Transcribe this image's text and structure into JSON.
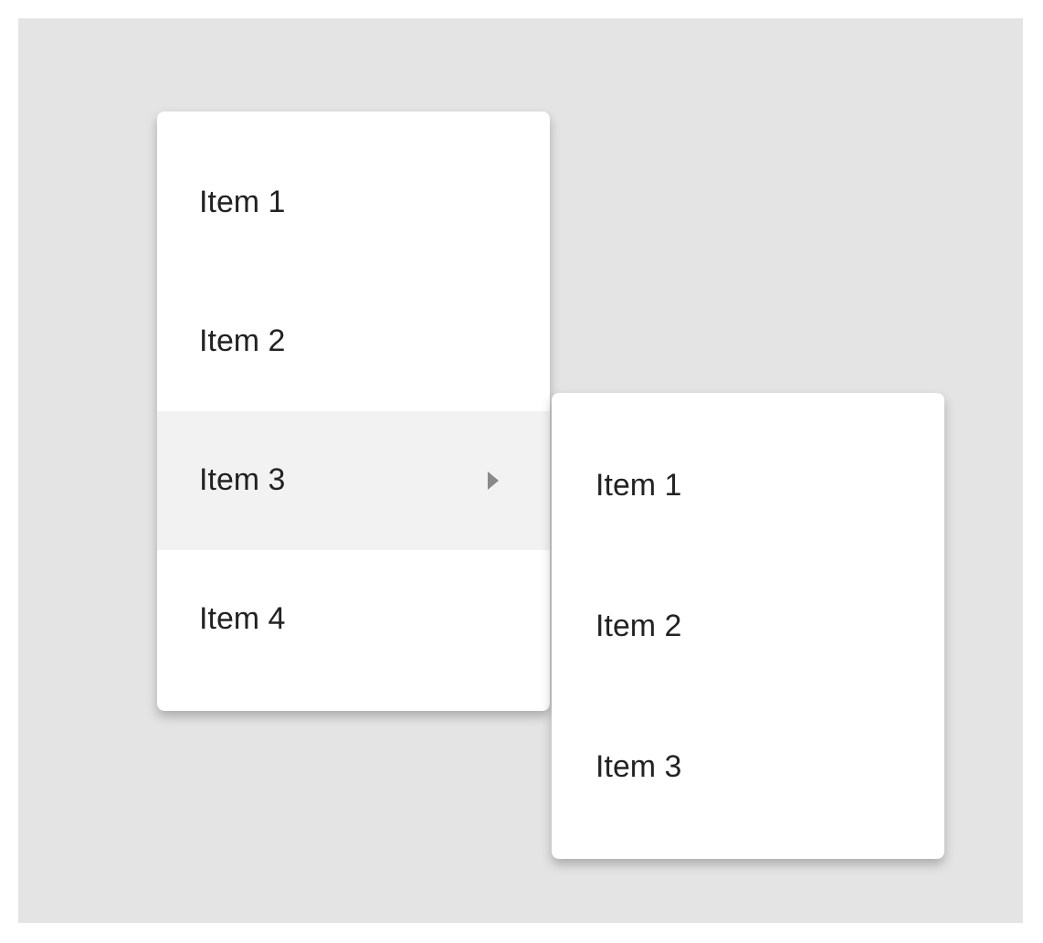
{
  "menu": {
    "items": [
      {
        "label": "Item 1",
        "selected": false,
        "has_submenu": false
      },
      {
        "label": "Item 2",
        "selected": false,
        "has_submenu": false
      },
      {
        "label": "Item 3",
        "selected": true,
        "has_submenu": true
      },
      {
        "label": "Item 4",
        "selected": false,
        "has_submenu": false
      }
    ]
  },
  "submenu": {
    "items": [
      {
        "label": "Item 1",
        "selected": false
      },
      {
        "label": "Item 2",
        "selected": false
      },
      {
        "label": "Item 3",
        "selected": false
      }
    ]
  }
}
